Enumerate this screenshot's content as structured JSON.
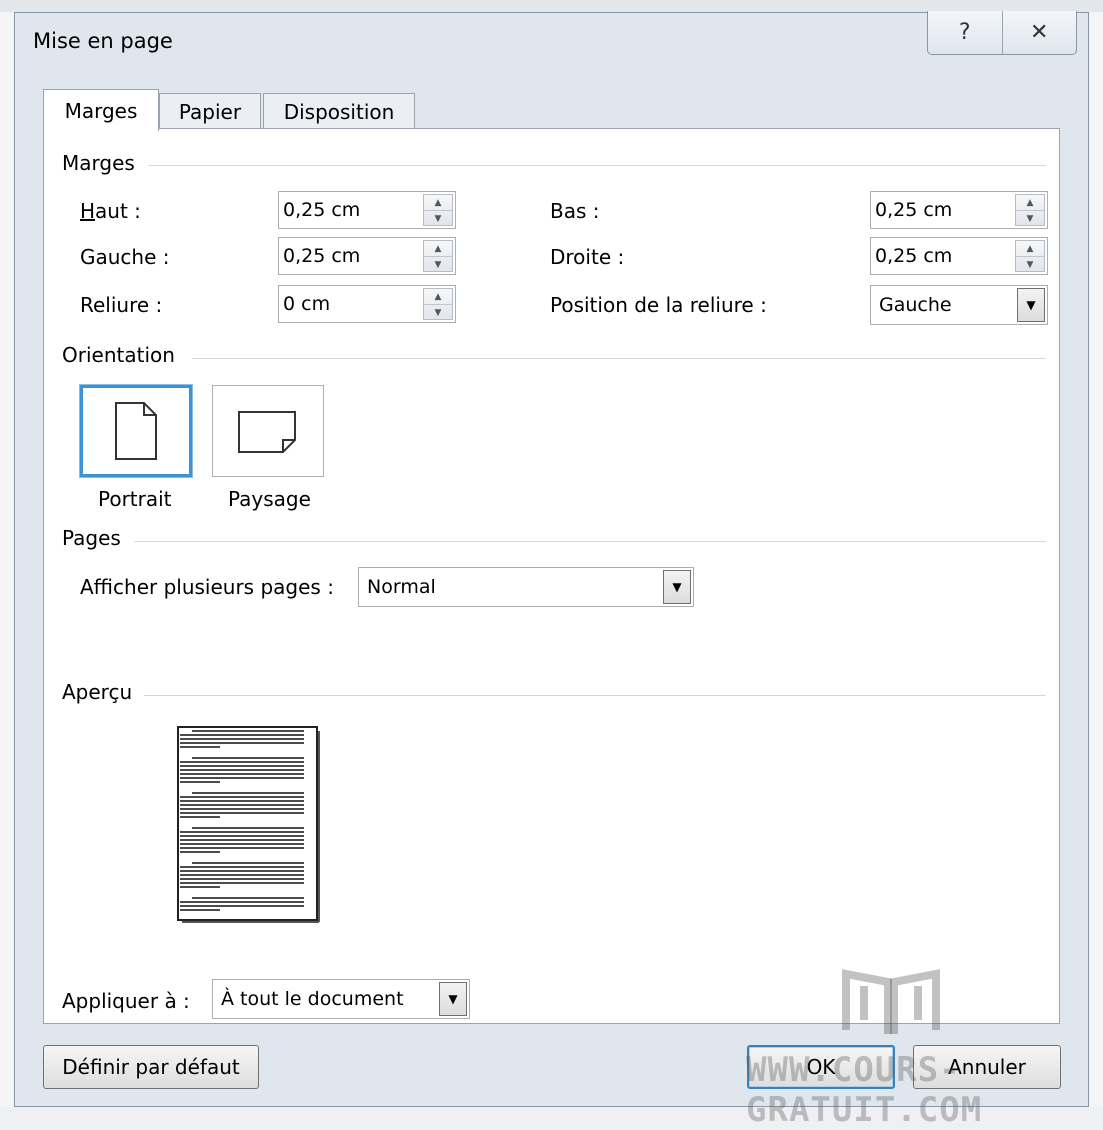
{
  "dialog": {
    "title": "Mise en page",
    "help_icon": "help-icon",
    "close_icon": "close-icon"
  },
  "tabs": [
    {
      "label": "Marges",
      "active": true
    },
    {
      "label": "Papier",
      "active": false
    },
    {
      "label": "Disposition",
      "active": false
    }
  ],
  "margins": {
    "section": "Marges",
    "top": {
      "label": "Haut :",
      "value": "0,25 cm"
    },
    "bottom": {
      "label": "Bas :",
      "value": "0,25 cm"
    },
    "left": {
      "label": "Gauche :",
      "value": "0,25 cm"
    },
    "right": {
      "label": "Droite :",
      "value": "0,25 cm"
    },
    "gutter": {
      "label": "Reliure :",
      "value": "0 cm"
    },
    "gutter_position": {
      "label": "Position de la reliure :",
      "value": "Gauche"
    }
  },
  "orientation": {
    "section": "Orientation",
    "portrait": "Portrait",
    "landscape": "Paysage",
    "selected": "Portrait"
  },
  "pages": {
    "section": "Pages",
    "multiple_label": "Afficher plusieurs pages :",
    "multiple_value": "Normal"
  },
  "preview": {
    "section": "Aperçu"
  },
  "apply": {
    "label": "Appliquer à :",
    "value": "À tout le document"
  },
  "buttons": {
    "default": "Définir par défaut",
    "ok": "OK",
    "cancel": "Annuler"
  },
  "colors": {
    "selection_border": "#3c92d6",
    "dialog_bg": "#dfe6ee",
    "panel_bg": "#ffffff"
  },
  "watermark": "WWW.COURS-GRATUIT.COM"
}
